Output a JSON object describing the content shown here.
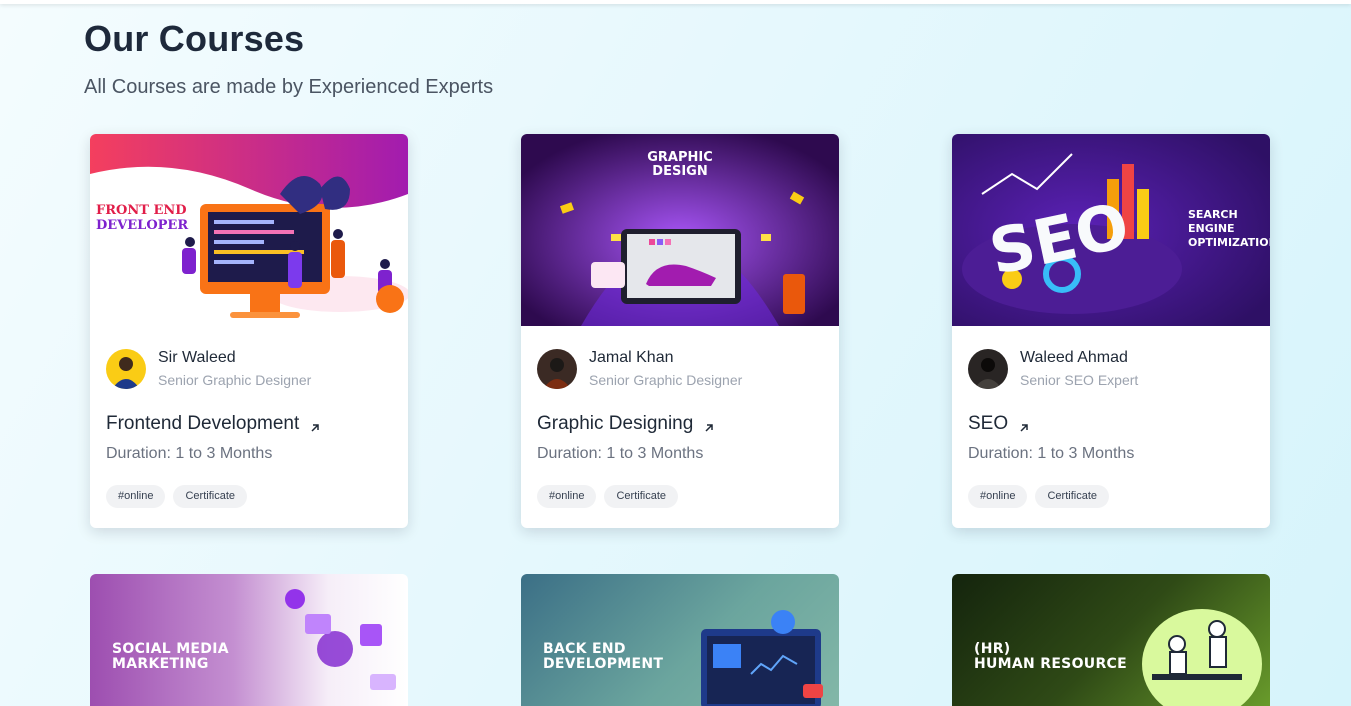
{
  "section": {
    "title": "Our Courses",
    "subtitle": "All Courses are made by Experienced Experts"
  },
  "courses": [
    {
      "image_text": [
        "FRONT END",
        "DEVELOPER"
      ],
      "author": "Sir Waleed",
      "role": "Senior Graphic Designer",
      "title": "Frontend Development",
      "duration": "Duration: 1 to 3 Months",
      "tags": [
        "#online",
        "Certificate"
      ]
    },
    {
      "image_text": [
        "GRAPHIC",
        "DESIGN"
      ],
      "author": "Jamal Khan",
      "role": "Senior Graphic Designer",
      "title": "Graphic Designing",
      "duration": "Duration: 1 to 3 Months",
      "tags": [
        "#online",
        "Certificate"
      ]
    },
    {
      "image_text": [
        "SEO",
        "SEARCH",
        "ENGINE",
        "OPTIMIZATION"
      ],
      "author": "Waleed Ahmad",
      "role": "Senior SEO Expert",
      "title": "SEO",
      "duration": "Duration: 1 to 3 Months",
      "tags": [
        "#online",
        "Certificate"
      ]
    }
  ],
  "more_courses": [
    {
      "image_text": [
        "SOCIAL MEDIA",
        "MARKETING"
      ],
      "accent": "#a855b7"
    },
    {
      "image_text": [
        "BACK END",
        "DEVELOPMENT"
      ],
      "accent": "#3e8fa0"
    },
    {
      "image_text": [
        "(HR)",
        "HUMAN RESOURCE"
      ],
      "accent": "#4d7c1f"
    }
  ],
  "icons": {
    "external_link": "arrow-up-right-icon"
  },
  "colors": {
    "accent_purple": "#7c3aed",
    "background": "#e6f8fd"
  }
}
